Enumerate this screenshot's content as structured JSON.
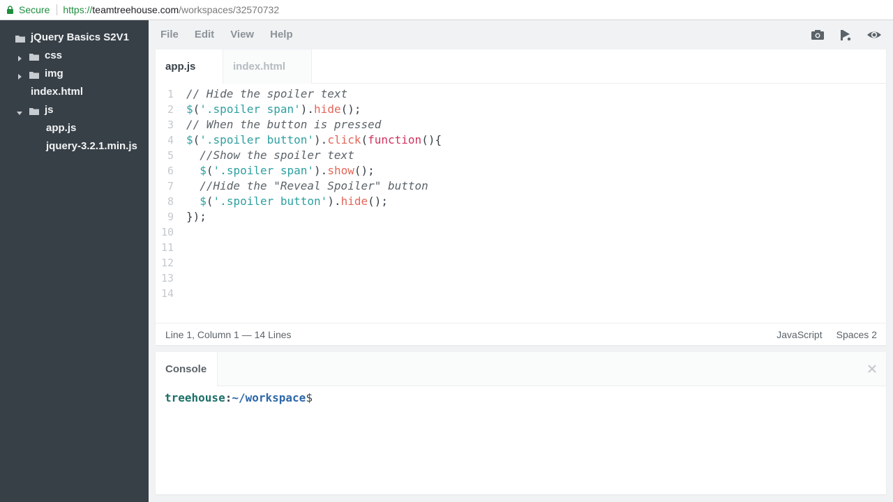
{
  "browser": {
    "secure_label": "Secure",
    "url_protocol": "https://",
    "url_host": "teamtreehouse.com",
    "url_path": "/workspaces/32570732"
  },
  "sidebar": {
    "project": "jQuery Basics S2V1",
    "items": [
      {
        "label": "css",
        "type": "folder",
        "expanded": false
      },
      {
        "label": "img",
        "type": "folder",
        "expanded": false
      },
      {
        "label": "index.html",
        "type": "file"
      },
      {
        "label": "js",
        "type": "folder",
        "expanded": true
      },
      {
        "label": "app.js",
        "type": "file"
      },
      {
        "label": "jquery-3.2.1.min.js",
        "type": "file"
      }
    ]
  },
  "menu": {
    "file": "File",
    "edit": "Edit",
    "view": "View",
    "help": "Help",
    "icons": [
      "camera-icon",
      "share-icon",
      "preview-eye-icon"
    ]
  },
  "editor": {
    "tabs": [
      {
        "label": "app.js",
        "active": true
      },
      {
        "label": "index.html",
        "active": false
      }
    ],
    "line_numbers": [
      "1",
      "2",
      "3",
      "4",
      "5",
      "6",
      "7",
      "8",
      "9",
      "10",
      "11",
      "12",
      "13",
      "14"
    ],
    "status_position": "Line 1, Column 1 — 14 Lines",
    "status_language": "JavaScript",
    "status_spaces_label": "Spaces",
    "status_spaces_value": "2"
  },
  "console": {
    "tab_label": "Console",
    "prompt_user": "treehouse",
    "prompt_colon": ":",
    "prompt_path": "~/workspace",
    "prompt_dollar": "$"
  },
  "colors": {
    "sidebar_bg": "#384047",
    "secure_green": "#1e8e3e",
    "string": "#2e9fa0",
    "method": "#e36659",
    "keyword": "#d1325d"
  }
}
